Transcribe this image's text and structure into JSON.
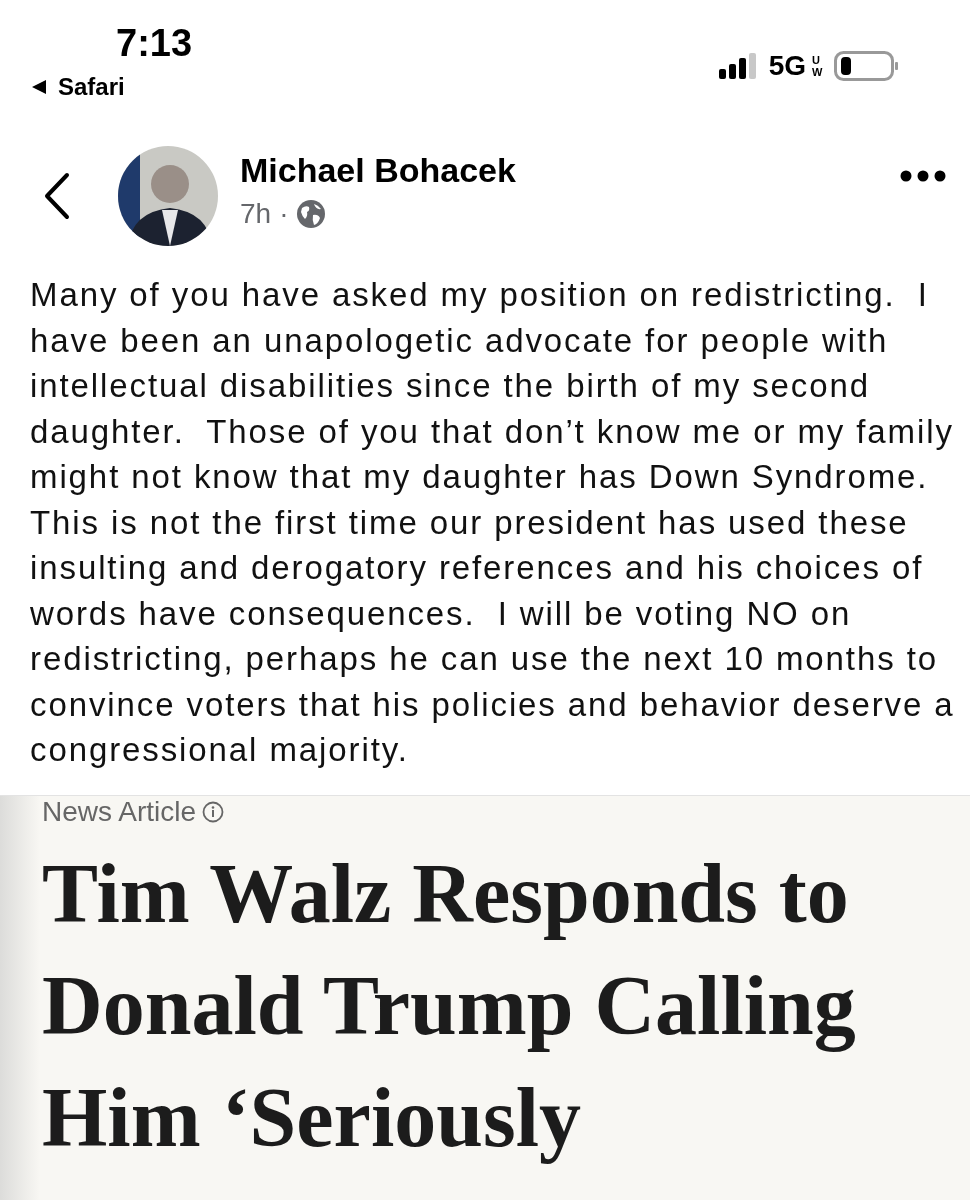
{
  "status_bar": {
    "time": "7:13",
    "back_app": "Safari",
    "network": "5G",
    "network_badge": "UW"
  },
  "post": {
    "author": "Michael Bohacek",
    "age": "7h",
    "separator": "·",
    "text": "Many of you have asked my position on redistricting.  I have been an unapologetic advocate for people with intellectual disabilities since the birth of my second daughter.  Those of you that don’t know me or my family might not know that my daughter has Down Syndrome.  This is not the first time our president has used these insulting and derogatory references and his choices of words have consequences.  I will be voting NO on redistricting, perhaps he can use the next 10 months to convince voters that his policies and behavior deserve a congressional majority."
  },
  "article": {
    "label": "News Article",
    "headline": "Tim Walz Responds to Donald Trump Calling Him ‘Seriously"
  }
}
